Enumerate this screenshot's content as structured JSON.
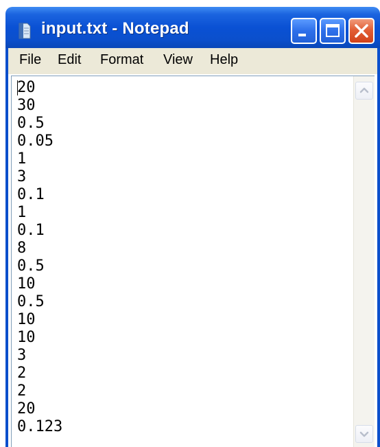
{
  "window": {
    "title": "input.txt - Notepad",
    "colors": {
      "titlebar": "#0a51d4",
      "menubar": "#ece9d8",
      "close_button": "#d2421a"
    }
  },
  "titlebar": {
    "app_icon": "notepad-icon",
    "buttons": [
      {
        "name": "minimize",
        "icon": "minimize-icon"
      },
      {
        "name": "maximize",
        "icon": "maximize-icon"
      },
      {
        "name": "close",
        "icon": "close-icon"
      }
    ]
  },
  "menu": {
    "file": "File",
    "edit": "Edit",
    "format": "Format",
    "view": "View",
    "help": "Help"
  },
  "editor": {
    "lines": [
      "20",
      "30",
      "0.5",
      "0.05",
      "1",
      "3",
      "0.1",
      "1",
      "0.1",
      "8",
      "0.5",
      "10",
      "0.5",
      "10",
      "10",
      "3",
      "2",
      "2",
      "20",
      "0.123"
    ]
  },
  "scrollbar": {
    "up_icon": "chevron-up-icon",
    "down_icon": "chevron-down-icon"
  }
}
